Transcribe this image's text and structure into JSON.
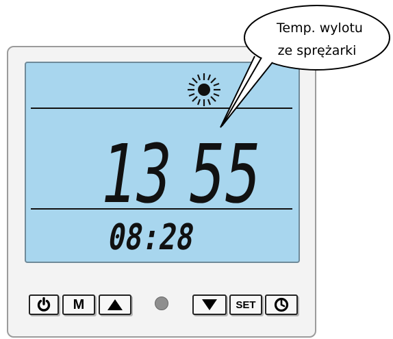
{
  "display": {
    "main_left": "13",
    "main_right": "55",
    "clock": "08:28",
    "mode_icon": "sun-icon"
  },
  "callout": {
    "line1": "Temp. wylotu",
    "line2": "ze sprężarki"
  },
  "buttons": {
    "power_icon": "power-icon",
    "mode_label": "M",
    "up_icon": "up-arrow-icon",
    "down_icon": "down-arrow-icon",
    "set_label": "SET",
    "clock_icon": "clock-icon"
  },
  "indicator": {
    "name": "status-led",
    "color": "#8e8e8e"
  },
  "colors": {
    "lcd_background": "#a8d6ee",
    "segment": "#111111",
    "panel": "#f3f3f3"
  }
}
